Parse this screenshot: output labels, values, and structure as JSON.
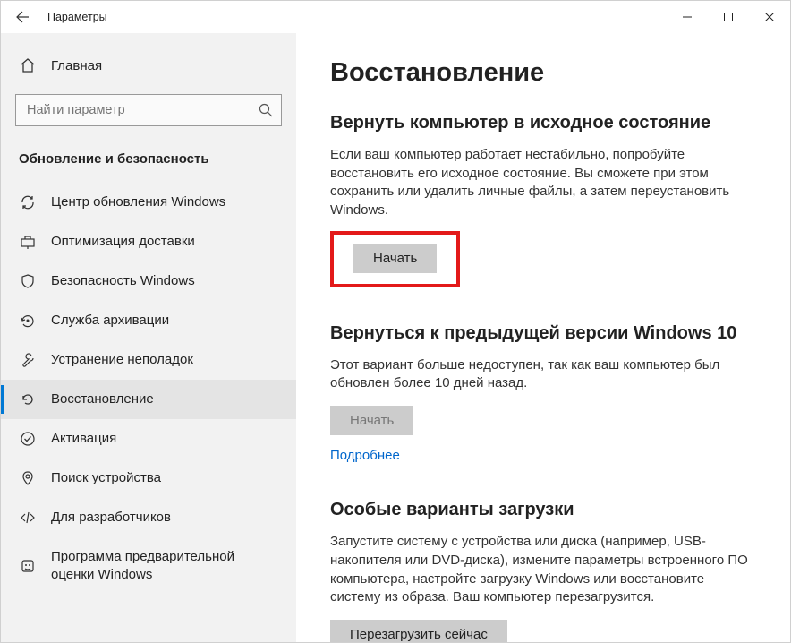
{
  "titlebar": {
    "title": "Параметры"
  },
  "sidebar": {
    "home": "Главная",
    "search_placeholder": "Найти параметр",
    "category": "Обновление и безопасность",
    "items": [
      {
        "label": "Центр обновления Windows"
      },
      {
        "label": "Оптимизация доставки"
      },
      {
        "label": "Безопасность Windows"
      },
      {
        "label": "Служба архивации"
      },
      {
        "label": "Устранение неполадок"
      },
      {
        "label": "Восстановление"
      },
      {
        "label": "Активация"
      },
      {
        "label": "Поиск устройства"
      },
      {
        "label": "Для разработчиков"
      },
      {
        "label": "Программа предварительной оценки Windows"
      }
    ]
  },
  "content": {
    "heading": "Восстановление",
    "section1": {
      "title": "Вернуть компьютер в исходное состояние",
      "desc": "Если ваш компьютер работает нестабильно, попробуйте восстановить его исходное состояние. Вы сможете при этом сохранить или удалить личные файлы, а затем переустановить Windows.",
      "button": "Начать"
    },
    "section2": {
      "title": "Вернуться к предыдущей версии Windows 10",
      "desc": "Этот вариант больше недоступен, так как ваш компьютер был обновлен более 10 дней назад.",
      "button": "Начать",
      "link": "Подробнее"
    },
    "section3": {
      "title": "Особые варианты загрузки",
      "desc": "Запустите систему с устройства или диска (например, USB-накопителя или DVD-диска), измените параметры встроенного ПО компьютера, настройте загрузку Windows или восстановите систему из образа. Ваш компьютер перезагрузится.",
      "button": "Перезагрузить сейчас"
    }
  }
}
